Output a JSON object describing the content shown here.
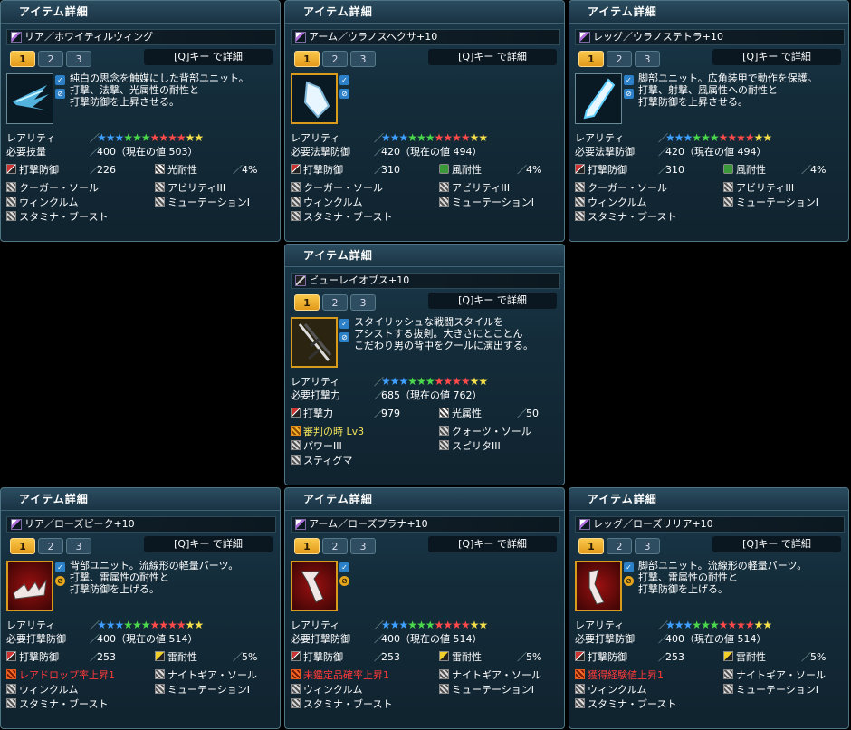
{
  "panels": [
    {
      "header": "アイテム詳細",
      "name": "リア／ホワイティルウィング",
      "tabs": [
        "1",
        "2",
        "3"
      ],
      "qkey": "[Q]キー で詳細",
      "desc": "純白の思念を触媒にした背部ユニット。\n打撃、法撃、光属性の耐性と\n打撃防御を上昇させる。",
      "rarity_label": "レアリティ",
      "req_label": "必要技量",
      "req_value": "400（現在の値 503）",
      "stat1_label": "打撃防御",
      "stat1_value": "226",
      "stat2_label": "光耐性",
      "stat2_value": "4%",
      "abilities": [
        "クーガー・ソール",
        "アビリティIII",
        "ウィンクルム",
        "ミューテーションI",
        "スタミナ・ブースト"
      ]
    },
    {
      "header": "アイテム詳細",
      "name": "アーム／ウラノスヘクサ+10",
      "tabs": [
        "1",
        "2",
        "3"
      ],
      "qkey": "[Q]キー で詳細",
      "desc": "",
      "rarity_label": "レアリティ",
      "req_label": "必要法撃防御",
      "req_value": "420（現在の値 494）",
      "stat1_label": "打撃防御",
      "stat1_value": "310",
      "stat2_label": "風耐性",
      "stat2_value": "4%",
      "abilities": [
        "クーガー・ソール",
        "アビリティIII",
        "ウィンクルム",
        "ミューテーションI",
        "スタミナ・ブースト"
      ]
    },
    {
      "header": "アイテム詳細",
      "name": "レッグ／ウラノステトラ+10",
      "tabs": [
        "1",
        "2",
        "3"
      ],
      "qkey": "[Q]キー で詳細",
      "desc": "脚部ユニット。広角装甲で動作を保護。\n打撃、射撃、風属性への耐性と\n打撃防御を上昇させる。",
      "rarity_label": "レアリティ",
      "req_label": "必要法撃防御",
      "req_value": "420（現在の値 494）",
      "stat1_label": "打撃防御",
      "stat1_value": "310",
      "stat2_label": "風耐性",
      "stat2_value": "4%",
      "abilities": [
        "クーガー・ソール",
        "アビリティIII",
        "ウィンクルム",
        "ミューテーションI",
        "スタミナ・ブースト"
      ]
    },
    {
      "header": "アイテム詳細",
      "name": "ビューレイオブス+10",
      "tabs": [
        "1",
        "2",
        "3"
      ],
      "qkey": "[Q]キー で詳細",
      "desc": "スタイリッシュな戦闘スタイルを\nアシストする抜剣。大きさにとことん\nこだわり男の背中をクールに演出する。",
      "rarity_label": "レアリティ",
      "req_label": "必要打撃力",
      "req_value": "685（現在の値 762）",
      "stat1_label": "打撃力",
      "stat1_value": "979",
      "stat2_label": "光属性",
      "stat2_value": "50",
      "abilities": [
        "審判の時 Lv3",
        "クォーツ・ソール",
        "パワーIII",
        "スピリタIII",
        "スティグマ"
      ]
    },
    {
      "header": "アイテム詳細",
      "name": "リア／ローズピーク+10",
      "tabs": [
        "1",
        "2",
        "3"
      ],
      "qkey": "[Q]キー で詳細",
      "desc": "背部ユニット。流線形の軽量パーツ。\n打撃、雷属性の耐性と\n打撃防御を上げる。",
      "rarity_label": "レアリティ",
      "req_label": "必要打撃防御",
      "req_value": "400（現在の値 514）",
      "stat1_label": "打撃防御",
      "stat1_value": "253",
      "stat2_label": "雷耐性",
      "stat2_value": "5%",
      "abilities": [
        "レアドロップ率上昇1",
        "ナイトギア・ソール",
        "ウィンクルム",
        "ミューテーションI",
        "スタミナ・ブースト"
      ]
    },
    {
      "header": "アイテム詳細",
      "name": "アーム／ローズプラナ+10",
      "tabs": [
        "1",
        "2",
        "3"
      ],
      "qkey": "[Q]キー で詳細",
      "desc": "",
      "rarity_label": "レアリティ",
      "req_label": "必要打撃防御",
      "req_value": "400（現在の値 514）",
      "stat1_label": "打撃防御",
      "stat1_value": "253",
      "stat2_label": "雷耐性",
      "stat2_value": "5%",
      "abilities": [
        "未鑑定品確率上昇1",
        "ナイトギア・ソール",
        "ウィンクルム",
        "ミューテーションI",
        "スタミナ・ブースト"
      ]
    },
    {
      "header": "アイテム詳細",
      "name": "レッグ／ローズリリア+10",
      "tabs": [
        "1",
        "2",
        "3"
      ],
      "qkey": "[Q]キー で詳細",
      "desc": "脚部ユニット。流線形の軽量パーツ。\n打撃、雷属性の耐性と\n打撃防御を上げる。",
      "rarity_label": "レアリティ",
      "req_label": "必要打撃防御",
      "req_value": "400（現在の値 514）",
      "stat1_label": "打撃防御",
      "stat1_value": "253",
      "stat2_label": "雷耐性",
      "stat2_value": "5%",
      "abilities": [
        "獲得経験値上昇1",
        "ナイトギア・ソール",
        "ウィンクルム",
        "ミューテーションI",
        "スタミナ・ブースト"
      ]
    }
  ],
  "rarity_stars": 12,
  "star_colors": [
    "#3fa0ff",
    "#3fa0ff",
    "#3fa0ff",
    "#4cd84c",
    "#4cd84c",
    "#4cd84c",
    "#ff4a4a",
    "#ff4a4a",
    "#ff4a4a",
    "#ff4a4a",
    "#f5e04a",
    "#f5e04a"
  ]
}
